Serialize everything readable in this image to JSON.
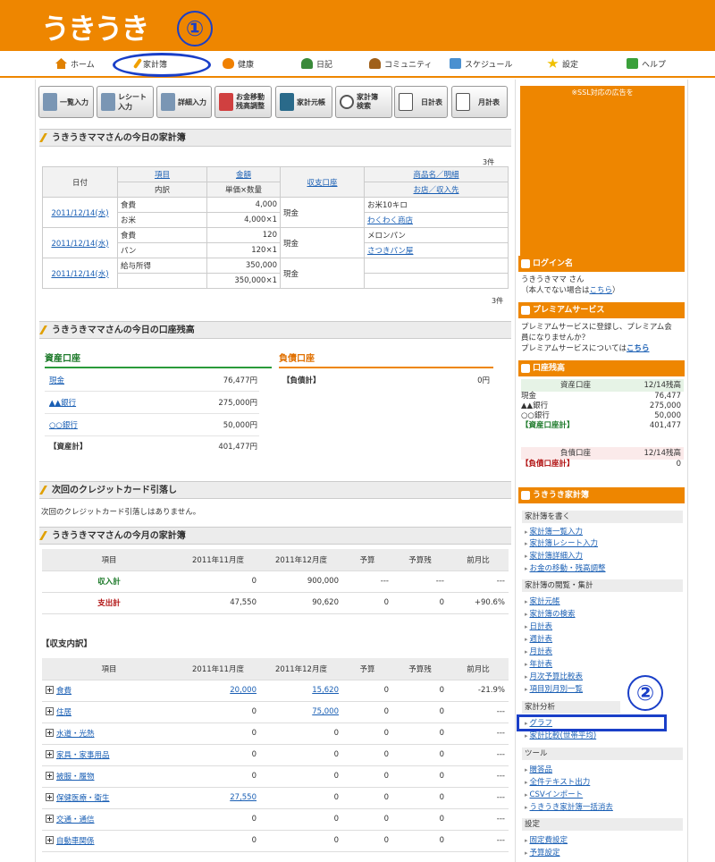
{
  "header": {
    "logo": "うきうき",
    "annotation1": "①",
    "annotation2": "②"
  },
  "nav": [
    {
      "label": "ホーム",
      "icon": "home-icon",
      "color": "#e08000"
    },
    {
      "label": "家計簿",
      "icon": "pencil-icon",
      "color": "#f0a000"
    },
    {
      "label": "健康",
      "icon": "heart-icon",
      "color": "#f08000"
    },
    {
      "label": "日記",
      "icon": "person-icon",
      "color": "#3a8a3a"
    },
    {
      "label": "コミュニティ",
      "icon": "people-icon",
      "color": "#a0601a"
    },
    {
      "label": "スケジュール",
      "icon": "calendar-icon",
      "color": "#4a90d0"
    },
    {
      "label": "設定",
      "icon": "star-icon",
      "color": "#f0c000"
    },
    {
      "label": "ヘルプ",
      "icon": "help-icon",
      "color": "#3aa03a"
    }
  ],
  "toolbar": [
    {
      "label": "一覧入力"
    },
    {
      "label": "レシート入力"
    },
    {
      "label": "詳細入力"
    },
    {
      "label": "お金移動 残高調整"
    },
    {
      "label": "家計元帳"
    },
    {
      "label": "家計簿 検索"
    },
    {
      "label": "日計表"
    },
    {
      "label": "月計表"
    }
  ],
  "today": {
    "title": "うきうきママさんの今日の家計簿",
    "count": "3件",
    "headers": {
      "date": "日付",
      "item": "項目",
      "detail": "内訳",
      "amount": "金額",
      "unit": "単価×数量",
      "account": "収支口座",
      "product": "商品名／明細",
      "shop": "お店／収入先"
    },
    "rows": [
      {
        "date": "2011/12/14(水)",
        "item": "食費",
        "amount": "4,000",
        "detail": "お米",
        "unit": "4,000×1",
        "account": "現金",
        "product": "お米10キロ",
        "shop": "わくわく商店"
      },
      {
        "date": "2011/12/14(水)",
        "item": "食費",
        "amount": "120",
        "detail": "パン",
        "unit": "120×1",
        "account": "現金",
        "product": "メロンパン",
        "shop": "さつきパン屋"
      },
      {
        "date": "2011/12/14(水)",
        "item": "給与所得",
        "amount": "350,000",
        "detail": "",
        "unit": "350,000×1",
        "account": "現金",
        "product": "",
        "shop": ""
      }
    ]
  },
  "balance": {
    "title": "うきうきママさんの今日の口座残高",
    "assets_title": "資産口座",
    "liab_title": "負債口座",
    "assets": [
      {
        "name": "現金",
        "value": "76,477円"
      },
      {
        "name": "▲▲銀行",
        "value": "275,000円"
      },
      {
        "name": "○○銀行",
        "value": "50,000円"
      },
      {
        "name": "【資産計】",
        "value": "401,477円"
      }
    ],
    "liab": [
      {
        "name": "【負債計】",
        "value": "0円"
      }
    ]
  },
  "credit": {
    "title": "次回のクレジットカード引落し",
    "text": "次回のクレジットカード引落しはありません。"
  },
  "month": {
    "title": "うきうきママさんの今月の家計簿",
    "headers": [
      "項目",
      "2011年11月度",
      "2011年12月度",
      "予算",
      "予算残",
      "前月比"
    ],
    "rows": [
      {
        "name": "収入計",
        "c1": "0",
        "c2": "900,000",
        "c3": "---",
        "c4": "---",
        "c5": "---"
      },
      {
        "name": "支出計",
        "c1": "47,550",
        "c2": "90,620",
        "c3": "0",
        "c4": "0",
        "c5": "+90.6%"
      }
    ]
  },
  "breakdown": {
    "title": "【収支内訳】",
    "headers": [
      "項目",
      "2011年11月度",
      "2011年12月度",
      "予算",
      "予算残",
      "前月比"
    ],
    "rows": [
      {
        "name": "食費",
        "c1": "20,000",
        "c2": "15,620",
        "c3": "0",
        "c4": "0",
        "c5": "-21.9%"
      },
      {
        "name": "住居",
        "c1": "0",
        "c2": "75,000",
        "c3": "0",
        "c4": "0",
        "c5": "---"
      },
      {
        "name": "水道・光熱",
        "c1": "0",
        "c2": "0",
        "c3": "0",
        "c4": "0",
        "c5": "---"
      },
      {
        "name": "家具・家事用品",
        "c1": "0",
        "c2": "0",
        "c3": "0",
        "c4": "0",
        "c5": "---"
      },
      {
        "name": "被服・履物",
        "c1": "0",
        "c2": "0",
        "c3": "0",
        "c4": "0",
        "c5": "---"
      },
      {
        "name": "保健医療・衛生",
        "c1": "27,550",
        "c2": "0",
        "c3": "0",
        "c4": "0",
        "c5": "---"
      },
      {
        "name": "交通・通信",
        "c1": "0",
        "c2": "0",
        "c3": "0",
        "c4": "0",
        "c5": "---"
      },
      {
        "name": "自動車関係",
        "c1": "0",
        "c2": "0",
        "c3": "0",
        "c4": "0",
        "c5": "---"
      }
    ]
  },
  "sidebar": {
    "ad": "※SSL対応の広告を",
    "login": {
      "title": "ログイン名",
      "line1": "うきうきママ さん",
      "line2_pre": "（本人でない場合は",
      "line2_link": "こちら",
      "line2_post": "）"
    },
    "premium": {
      "title": "プレミアムサービス",
      "line1": "プレミアムサービスに登録し、プレミアム会",
      "line2": "員になりませんか？",
      "line3_pre": "プレミアムサービスについては",
      "line3_link": "こちら"
    },
    "balance": {
      "title": "口座残高",
      "asset_head": "資産口座",
      "asset_date": "12/14残高",
      "assets": [
        {
          "name": "現金",
          "value": "76,477"
        },
        {
          "name": "▲▲銀行",
          "value": "275,000"
        },
        {
          "name": "○○銀行",
          "value": "50,000"
        },
        {
          "name": "【資産口座計】",
          "value": "401,477"
        }
      ],
      "liab_head": "負債口座",
      "liab_date": "12/14残高",
      "liab": [
        {
          "name": "【負債口座計】",
          "value": "0"
        }
      ]
    },
    "menu": {
      "title": "うきうき家計簿",
      "groups": [
        {
          "head": "家計簿を書く",
          "items": [
            "家計簿一覧入力",
            "家計簿レシート入力",
            "家計簿詳細入力",
            "お金の移動・残高調整"
          ]
        },
        {
          "head": "家計簿の閲覧・集計",
          "items": [
            "家計元帳",
            "家計簿の検索",
            "日計表",
            "週計表",
            "月計表",
            "年計表",
            "月次予算比較表",
            "項目別月別一覧"
          ]
        },
        {
          "head": "家計分析",
          "items": [
            "グラフ",
            "家計比較(世帯平均)"
          ]
        },
        {
          "head": "ツール",
          "items": [
            "贈答品",
            "全件テキスト出力",
            "CSVインポート",
            "うきうき家計簿一括消去"
          ]
        },
        {
          "head": "設定",
          "items": [
            "固定費設定",
            "予算設定"
          ]
        }
      ]
    }
  }
}
